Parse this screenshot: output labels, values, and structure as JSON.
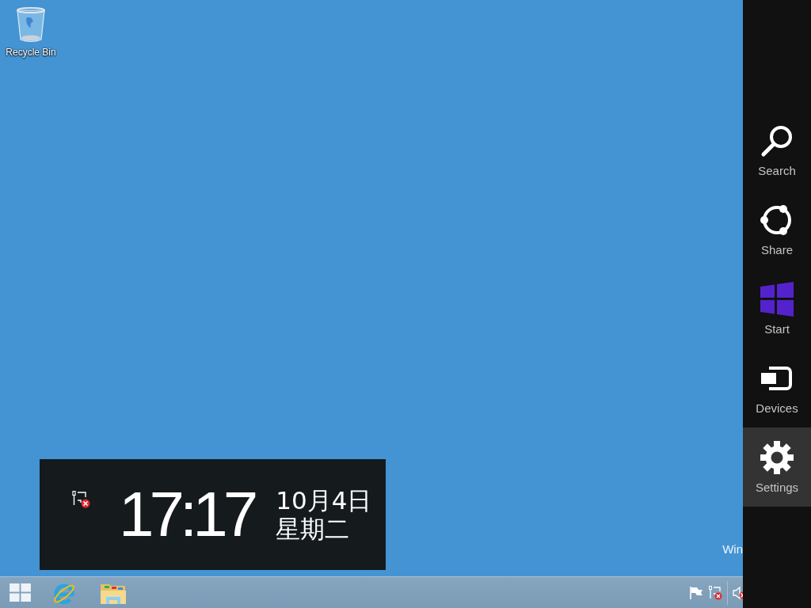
{
  "desktop": {
    "icons": [
      {
        "label": "Recycle Bin"
      }
    ],
    "corner_text": "Win"
  },
  "clock_overlay": {
    "time": "17:17",
    "date": "10月4日",
    "weekday": "星期二"
  },
  "charms": [
    {
      "label": "Search",
      "selected": false
    },
    {
      "label": "Share",
      "selected": false
    },
    {
      "label": "Start",
      "selected": false
    },
    {
      "label": "Devices",
      "selected": false
    },
    {
      "label": "Settings",
      "selected": true
    }
  ]
}
